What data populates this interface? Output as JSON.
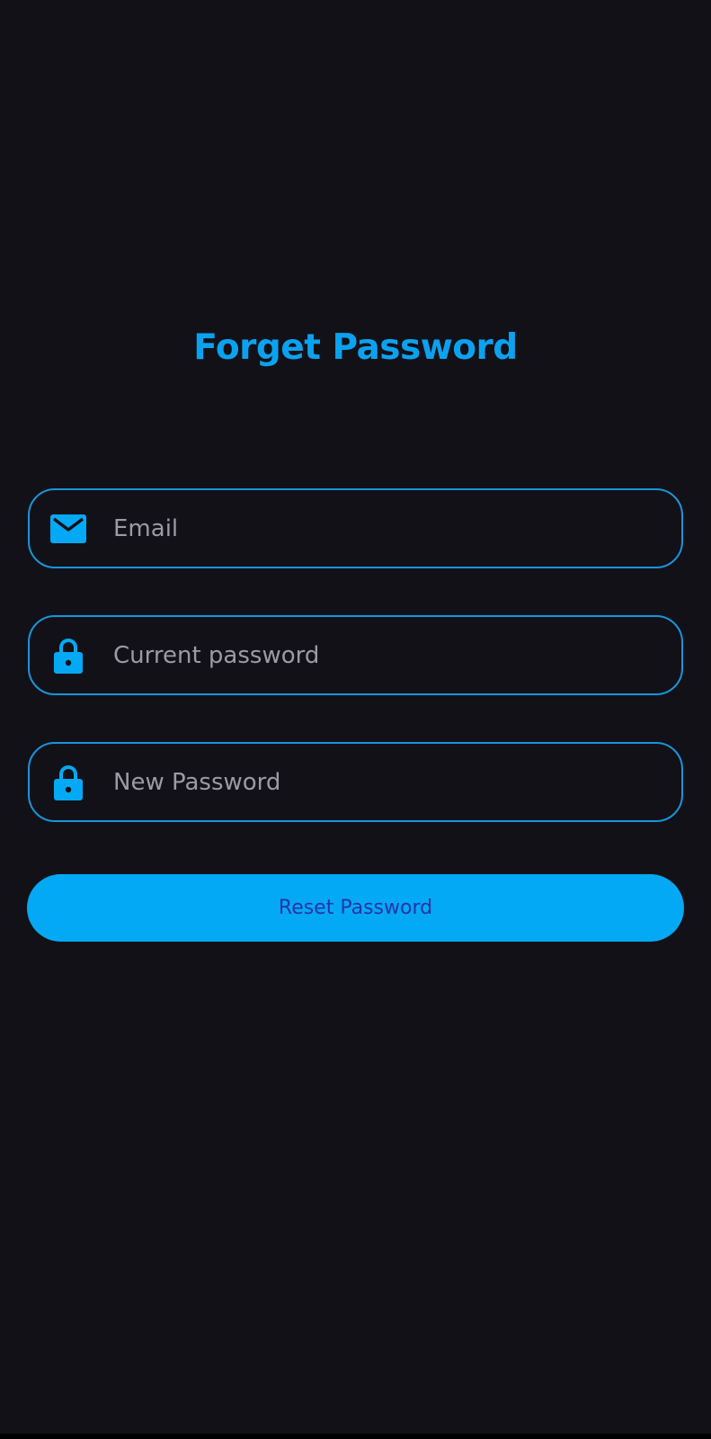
{
  "screen": {
    "title": "Forget Password"
  },
  "form": {
    "email": {
      "placeholder": "Email",
      "icon": "mail-icon"
    },
    "current_password": {
      "placeholder": "Current password",
      "icon": "lock-icon"
    },
    "new_password": {
      "placeholder": "New Password",
      "icon": "lock-icon"
    },
    "submit_label": "Reset Password"
  },
  "colors": {
    "background": "#121118",
    "accent": "#03a9f4",
    "field_border": "#1796db",
    "placeholder_text": "#9b9ba3",
    "button_text": "#2434a8"
  }
}
